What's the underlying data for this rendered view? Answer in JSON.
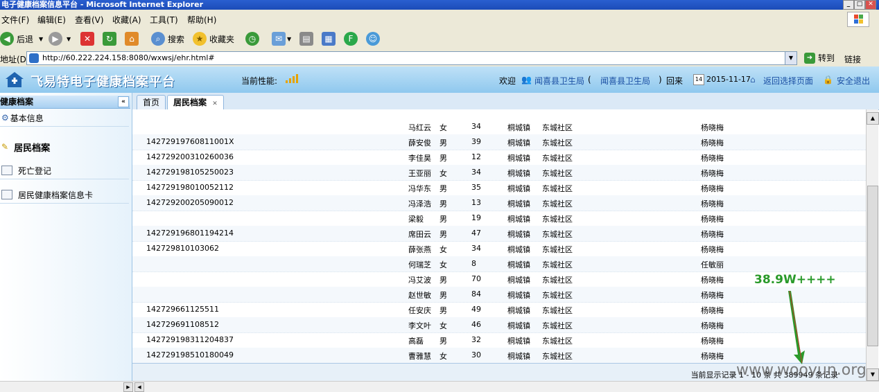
{
  "window": {
    "title": "电子健康档案信息平台 - Microsoft Internet Explorer"
  },
  "menu": [
    "文件(F)",
    "编辑(E)",
    "查看(V)",
    "收藏(A)",
    "工具(T)",
    "帮助(H)"
  ],
  "toolbar": {
    "back": "后退",
    "search": "搜索",
    "favorites": "收藏夹"
  },
  "address": {
    "label": "地址(D)",
    "url": "http://60.222.224.158:8080/wxwsj/ehr.html#",
    "go": "转到",
    "links": "链接"
  },
  "header": {
    "logo": "飞易特电子健康档案平台",
    "performance_label": "当前性能:",
    "welcome": "欢迎",
    "user": "闻喜县卫生局",
    "open_paren": "(",
    "org": "闻喜县卫生局",
    "close_paren": ")",
    "back_home": "回来",
    "date": "2015-11-17",
    "return_select": "返回选择页面",
    "logout": "安全退出"
  },
  "sidebar": {
    "title": "健康档案",
    "items": [
      {
        "label": "基本信息"
      },
      {
        "label": "居民档案"
      },
      {
        "label": "死亡登记"
      },
      {
        "label": "居民健康档案信息卡"
      }
    ]
  },
  "tabs": [
    {
      "label": "首页"
    },
    {
      "label": "居民档案"
    }
  ],
  "table": {
    "rows": [
      {
        "id": "",
        "name": "马红云",
        "sex": "女",
        "age": "34",
        "town": "桐城镇",
        "community": "东城社区",
        "doctor": "杨晓梅"
      },
      {
        "id": "14272919760811001X",
        "name": "薛安俊",
        "sex": "男",
        "age": "39",
        "town": "桐城镇",
        "community": "东城社区",
        "doctor": "杨晓梅"
      },
      {
        "id": "142729200310260036",
        "name": "李佳昊",
        "sex": "男",
        "age": "12",
        "town": "桐城镇",
        "community": "东城社区",
        "doctor": "杨晓梅"
      },
      {
        "id": "142729198105250023",
        "name": "王亚丽",
        "sex": "女",
        "age": "34",
        "town": "桐城镇",
        "community": "东城社区",
        "doctor": "杨晓梅"
      },
      {
        "id": "142729198010052112",
        "name": "冯华东",
        "sex": "男",
        "age": "35",
        "town": "桐城镇",
        "community": "东城社区",
        "doctor": "杨晓梅"
      },
      {
        "id": "142729200205090012",
        "name": "冯泽浩",
        "sex": "男",
        "age": "13",
        "town": "桐城镇",
        "community": "东城社区",
        "doctor": "杨晓梅"
      },
      {
        "id": "",
        "name": "梁毅",
        "sex": "男",
        "age": "19",
        "town": "桐城镇",
        "community": "东城社区",
        "doctor": "杨晓梅"
      },
      {
        "id": "142729196801194214",
        "name": "席田云",
        "sex": "男",
        "age": "47",
        "town": "桐城镇",
        "community": "东城社区",
        "doctor": "杨晓梅"
      },
      {
        "id": "14272981010306​2",
        "name": "薛张燕",
        "sex": "女",
        "age": "34",
        "town": "桐城镇",
        "community": "东城社区",
        "doctor": "杨晓梅"
      },
      {
        "id": "",
        "name": "何瑞芝",
        "sex": "女",
        "age": "8",
        "town": "桐城镇",
        "community": "东城社区",
        "doctor": "任敏丽"
      },
      {
        "id": "",
        "name": "冯艾波",
        "sex": "男",
        "age": "70",
        "town": "桐城镇",
        "community": "东城社区",
        "doctor": "杨晓梅"
      },
      {
        "id": "",
        "name": "赵世敏",
        "sex": "男",
        "age": "84",
        "town": "桐城镇",
        "community": "东城社区",
        "doctor": "杨晓梅"
      },
      {
        "id": "142729661125511",
        "name": "任安庆",
        "sex": "男",
        "age": "49",
        "town": "桐城镇",
        "community": "东城社区",
        "doctor": "杨晓梅"
      },
      {
        "id": "142729691108512",
        "name": "李文叶",
        "sex": "女",
        "age": "46",
        "town": "桐城镇",
        "community": "东城社区",
        "doctor": "杨晓梅"
      },
      {
        "id": "142729198311204837",
        "name": "高磊",
        "sex": "男",
        "age": "32",
        "town": "桐城镇",
        "community": "东城社区",
        "doctor": "杨晓梅"
      },
      {
        "id": "142729198510180049",
        "name": "曹雅慧",
        "sex": "女",
        "age": "30",
        "town": "桐城镇",
        "community": "东城社区",
        "doctor": "杨晓梅"
      }
    ]
  },
  "footer": {
    "status": "当前显示记录 1 - 10 条 共 389949 条记录"
  },
  "annotation": "38.9W++++",
  "watermark": "www.wooyun.org",
  "colors": {
    "header_bg": "#a9d6f5",
    "annotation": "#2a9a2a",
    "link": "#1a4fa3"
  }
}
